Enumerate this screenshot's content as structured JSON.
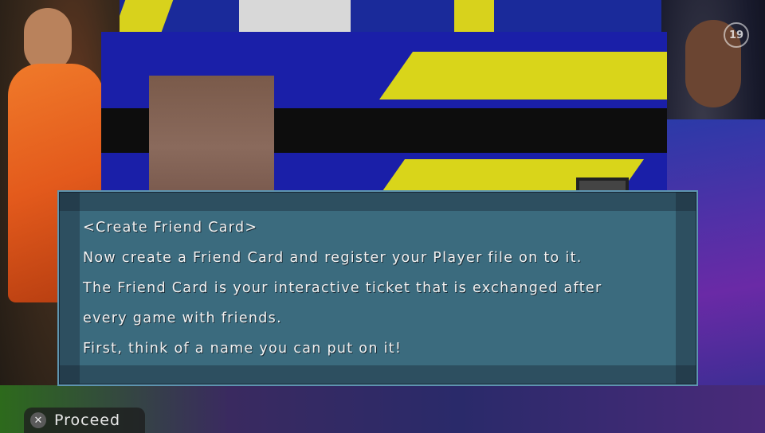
{
  "background": {
    "badge_text": "19"
  },
  "dialog": {
    "lines": [
      "<Create Friend Card>",
      "Now create a Friend Card and register your Player file on to it.",
      "The Friend Card is your interactive ticket that is exchanged after",
      "every game with friends.",
      "First, think of a name you can put on it!"
    ]
  },
  "footer": {
    "proceed_icon": "cross-button-icon",
    "proceed_icon_glyph": "✕",
    "proceed_label": "Proceed"
  },
  "colors": {
    "dialog_bg": "#3b6b7e",
    "dialog_border": "#5e95b0",
    "card_blue": "#1a1fa8",
    "card_yellow": "#d9d51a"
  }
}
